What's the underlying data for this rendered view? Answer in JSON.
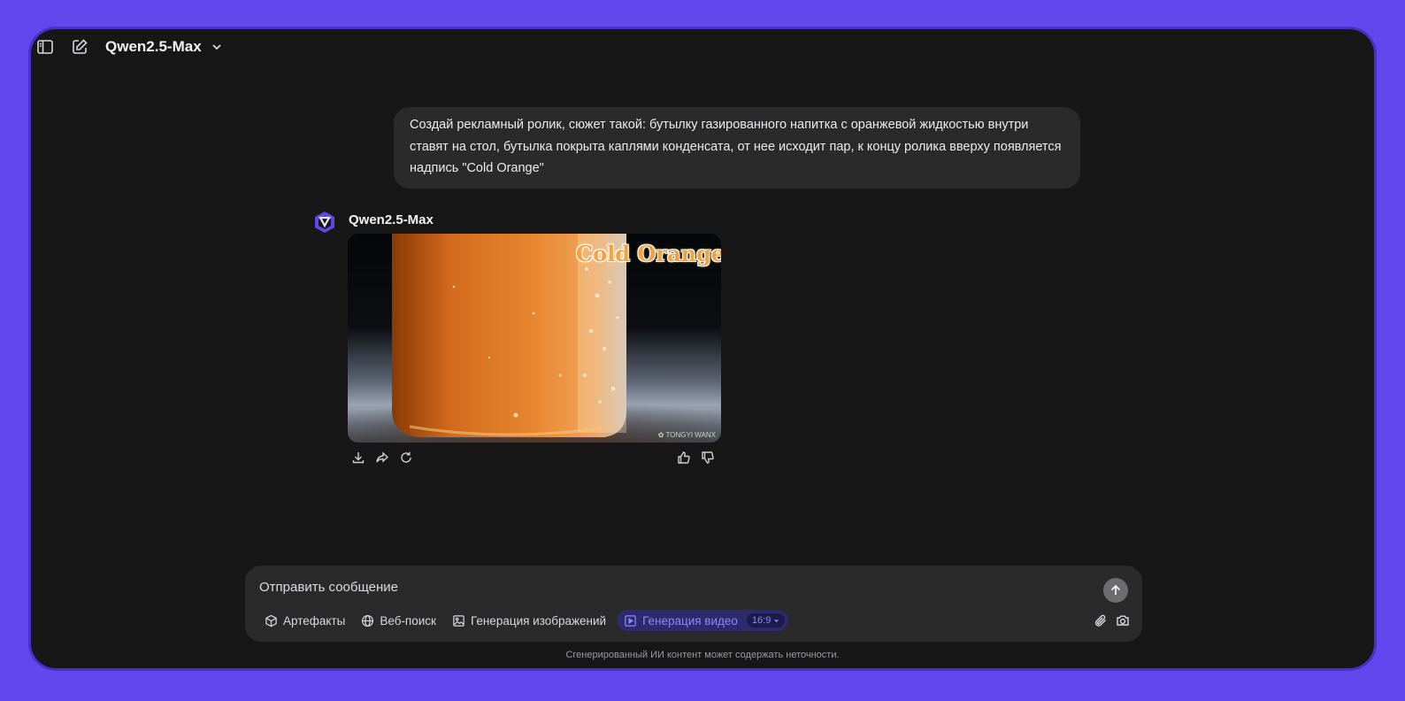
{
  "topbar": {
    "model_name": "Qwen2.5-Max",
    "icons": [
      "sidebar-toggle-icon",
      "new-chat-icon",
      "chevron-down-icon"
    ]
  },
  "conversation": {
    "user_message": "Создай рекламный ролик, сюжет такой: бутылку газированного напитка с оранжевой жидкостью внутри ставят на стол, бутылка покрыта каплями конденсата, от нее исходит пар, к концу ролика вверху появляется надпись \"Cold Orange\"",
    "assistant_name": "Qwen2.5-Max",
    "video_overlay_text": "Cold Orange",
    "video_watermark": "✿ TONGYI WANX",
    "actions_left": [
      "download-icon",
      "share-icon",
      "regenerate-icon"
    ],
    "actions_right": [
      "thumbs-up-icon",
      "thumbs-down-icon"
    ]
  },
  "composer": {
    "placeholder": "Отправить сообщение",
    "tools": [
      {
        "label": "Артефакты",
        "icon": "cube-icon",
        "active": false
      },
      {
        "label": "Веб-поиск",
        "icon": "globe-icon",
        "active": false
      },
      {
        "label": "Генерация изображений",
        "icon": "image-icon",
        "active": false
      },
      {
        "label": "Генерация видео",
        "icon": "video-icon",
        "active": true
      }
    ],
    "aspect_ratio": "16:9",
    "right_icons": [
      "attach-icon",
      "camera-icon"
    ]
  },
  "footer": {
    "disclaimer": "Сгенерированный ИИ контент может содержать неточности."
  },
  "colors": {
    "frame": "#6347ee",
    "window_bg": "#171717",
    "bubble_bg": "#2a2a2b",
    "accent": "#8f86ff"
  }
}
